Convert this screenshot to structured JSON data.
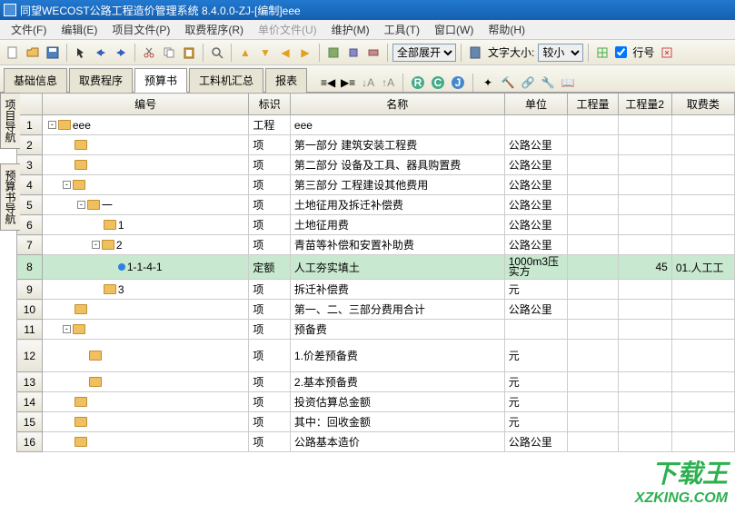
{
  "title": "同望WECOST公路工程造价管理系统  8.4.0.0-ZJ-[编制]eee",
  "menu": [
    "文件(F)",
    "编辑(E)",
    "项目文件(P)",
    "取费程序(R)",
    "单价文件(U)",
    "维护(M)",
    "工具(T)",
    "窗口(W)",
    "帮助(H)"
  ],
  "menu_disabled": [
    4
  ],
  "toolbar1": {
    "expand_label": "全部展开",
    "fontsize_label": "文字大小:",
    "fontsize_value": "较小",
    "lineno_label": "行号"
  },
  "tabs": [
    "基础信息",
    "取费程序",
    "预算书",
    "工料机汇总",
    "报表"
  ],
  "active_tab": 2,
  "side_tabs": [
    "项目导航",
    "预算书导航"
  ],
  "columns": [
    "",
    "编号",
    "标识",
    "名称",
    "单位",
    "工程量",
    "工程量2",
    "取费类"
  ],
  "rows": [
    {
      "n": 1,
      "indent": 0,
      "exp": "-",
      "icon": "folder",
      "code": "eee",
      "mark": "工程",
      "name": "eee",
      "unit": "",
      "q1": "",
      "q2": "",
      "fee": ""
    },
    {
      "n": 2,
      "indent": 1,
      "exp": "",
      "icon": "folder",
      "code": "",
      "mark": "项",
      "name": "第一部分 建筑安装工程费",
      "unit": "公路公里",
      "q1": "",
      "q2": "",
      "fee": ""
    },
    {
      "n": 3,
      "indent": 1,
      "exp": "",
      "icon": "folder",
      "code": "",
      "mark": "项",
      "name": "第二部分 设备及工具、器具购置费",
      "unit": "公路公里",
      "q1": "",
      "q2": "",
      "fee": ""
    },
    {
      "n": 4,
      "indent": 1,
      "exp": "-",
      "icon": "folder",
      "code": "",
      "mark": "项",
      "name": "第三部分 工程建设其他费用",
      "unit": "公路公里",
      "q1": "",
      "q2": "",
      "fee": ""
    },
    {
      "n": 5,
      "indent": 2,
      "exp": "-",
      "icon": "folder",
      "code": "一",
      "mark": "项",
      "name": "土地征用及拆迁补偿费",
      "unit": "公路公里",
      "q1": "",
      "q2": "",
      "fee": ""
    },
    {
      "n": 6,
      "indent": 3,
      "exp": "",
      "icon": "folder",
      "code": "1",
      "mark": "项",
      "name": "土地征用费",
      "unit": "公路公里",
      "q1": "",
      "q2": "",
      "fee": ""
    },
    {
      "n": 7,
      "indent": 3,
      "exp": "-",
      "icon": "folder",
      "code": "2",
      "mark": "项",
      "name": "青苗等补偿和安置补助费",
      "unit": "公路公里",
      "q1": "",
      "q2": "",
      "fee": ""
    },
    {
      "n": 8,
      "indent": 4,
      "exp": "",
      "icon": "bullet",
      "code": "1-1-4-1",
      "mark": "定额",
      "name": "人工夯实填土",
      "unit": "1000m3压实方",
      "q1": "",
      "q2": "45",
      "fee": "01.人工工",
      "selected": true
    },
    {
      "n": 9,
      "indent": 3,
      "exp": "",
      "icon": "folder",
      "code": "3",
      "mark": "项",
      "name": "拆迁补偿费",
      "unit": "元",
      "q1": "",
      "q2": "",
      "fee": ""
    },
    {
      "n": 10,
      "indent": 1,
      "exp": "",
      "icon": "folder",
      "code": "",
      "mark": "项",
      "name": "第一、二、三部分费用合计",
      "unit": "公路公里",
      "q1": "",
      "q2": "",
      "fee": ""
    },
    {
      "n": 11,
      "indent": 1,
      "exp": "-",
      "icon": "folder",
      "code": "",
      "mark": "项",
      "name": "预备费",
      "unit": "",
      "q1": "",
      "q2": "",
      "fee": ""
    },
    {
      "n": 12,
      "indent": 2,
      "exp": "",
      "icon": "folder",
      "code": "",
      "mark": "项",
      "name": "1.价差预备费",
      "unit": "元",
      "q1": "",
      "q2": "",
      "fee": "",
      "tall": true
    },
    {
      "n": 13,
      "indent": 2,
      "exp": "",
      "icon": "folder",
      "code": "",
      "mark": "项",
      "name": "2.基本预备费",
      "unit": "元",
      "q1": "",
      "q2": "",
      "fee": ""
    },
    {
      "n": 14,
      "indent": 1,
      "exp": "",
      "icon": "folder",
      "code": "",
      "mark": "项",
      "name": "投资估算总金额",
      "unit": "元",
      "q1": "",
      "q2": "",
      "fee": ""
    },
    {
      "n": 15,
      "indent": 1,
      "exp": "",
      "icon": "folder",
      "code": "",
      "mark": "项",
      "name": "其中：回收金额",
      "unit": "元",
      "q1": "",
      "q2": "",
      "fee": ""
    },
    {
      "n": 16,
      "indent": 1,
      "exp": "",
      "icon": "folder",
      "code": "",
      "mark": "项",
      "name": "公路基本造价",
      "unit": "公路公里",
      "q1": "",
      "q2": "",
      "fee": ""
    }
  ],
  "watermark": {
    "logo": "下载王",
    "url": "XZKING.COM"
  }
}
